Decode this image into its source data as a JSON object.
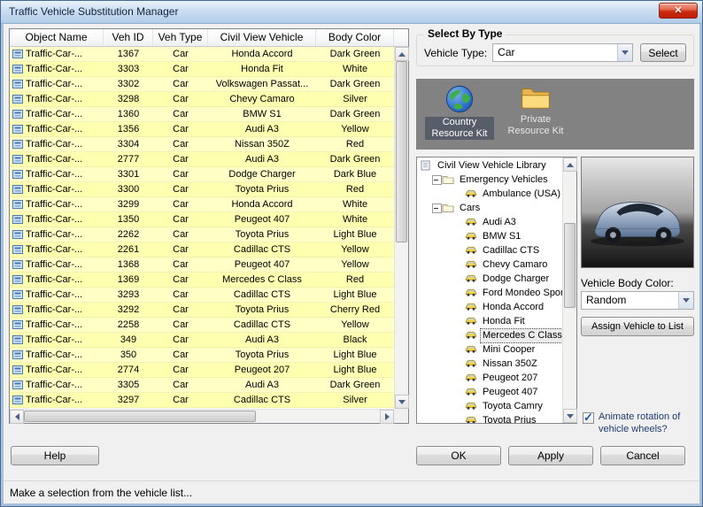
{
  "window": {
    "title": "Traffic Vehicle Substitution Manager"
  },
  "icons": {
    "close": "✕",
    "check": "✓"
  },
  "table": {
    "columns": [
      "Object Name",
      "Veh ID",
      "Veh Type",
      "Civil View Vehicle",
      "Body Color"
    ],
    "rows": [
      {
        "name": "Traffic-Car-...",
        "id": "1367",
        "type": "Car",
        "vehicle": "Honda Accord",
        "color": "Dark Green"
      },
      {
        "name": "Traffic-Car-...",
        "id": "3303",
        "type": "Car",
        "vehicle": "Honda Fit",
        "color": "White"
      },
      {
        "name": "Traffic-Car-...",
        "id": "3302",
        "type": "Car",
        "vehicle": "Volkswagen Passat...",
        "color": "Dark Green"
      },
      {
        "name": "Traffic-Car-...",
        "id": "3298",
        "type": "Car",
        "vehicle": "Chevy Camaro",
        "color": "Silver"
      },
      {
        "name": "Traffic-Car-...",
        "id": "1360",
        "type": "Car",
        "vehicle": "BMW S1",
        "color": "Dark Green"
      },
      {
        "name": "Traffic-Car-...",
        "id": "1356",
        "type": "Car",
        "vehicle": "Audi A3",
        "color": "Yellow"
      },
      {
        "name": "Traffic-Car-...",
        "id": "3304",
        "type": "Car",
        "vehicle": "Nissan 350Z",
        "color": "Red"
      },
      {
        "name": "Traffic-Car-...",
        "id": "2777",
        "type": "Car",
        "vehicle": "Audi A3",
        "color": "Dark Green"
      },
      {
        "name": "Traffic-Car-...",
        "id": "3301",
        "type": "Car",
        "vehicle": "Dodge Charger",
        "color": "Dark Blue"
      },
      {
        "name": "Traffic-Car-...",
        "id": "3300",
        "type": "Car",
        "vehicle": "Toyota Prius",
        "color": "Red"
      },
      {
        "name": "Traffic-Car-...",
        "id": "3299",
        "type": "Car",
        "vehicle": "Honda Accord",
        "color": "White"
      },
      {
        "name": "Traffic-Car-...",
        "id": "1350",
        "type": "Car",
        "vehicle": "Peugeot 407",
        "color": "White"
      },
      {
        "name": "Traffic-Car-...",
        "id": "2262",
        "type": "Car",
        "vehicle": "Toyota Prius",
        "color": "Light Blue"
      },
      {
        "name": "Traffic-Car-...",
        "id": "2261",
        "type": "Car",
        "vehicle": "Cadillac CTS",
        "color": "Yellow"
      },
      {
        "name": "Traffic-Car-...",
        "id": "1368",
        "type": "Car",
        "vehicle": "Peugeot 407",
        "color": "Yellow"
      },
      {
        "name": "Traffic-Car-...",
        "id": "1369",
        "type": "Car",
        "vehicle": "Mercedes C Class",
        "color": "Red"
      },
      {
        "name": "Traffic-Car-...",
        "id": "3293",
        "type": "Car",
        "vehicle": "Cadillac CTS",
        "color": "Light Blue"
      },
      {
        "name": "Traffic-Car-...",
        "id": "3292",
        "type": "Car",
        "vehicle": "Toyota Prius",
        "color": "Cherry Red"
      },
      {
        "name": "Traffic-Car-...",
        "id": "2258",
        "type": "Car",
        "vehicle": "Cadillac CTS",
        "color": "Yellow"
      },
      {
        "name": "Traffic-Car-...",
        "id": "349",
        "type": "Car",
        "vehicle": "Audi A3",
        "color": "Black"
      },
      {
        "name": "Traffic-Car-...",
        "id": "350",
        "type": "Car",
        "vehicle": "Toyota Prius",
        "color": "Light Blue"
      },
      {
        "name": "Traffic-Car-...",
        "id": "2774",
        "type": "Car",
        "vehicle": "Peugeot 207",
        "color": "Light Blue"
      },
      {
        "name": "Traffic-Car-...",
        "id": "3305",
        "type": "Car",
        "vehicle": "Audi A3",
        "color": "Dark Green"
      },
      {
        "name": "Traffic-Car-...",
        "id": "3297",
        "type": "Car",
        "vehicle": "Cadillac CTS",
        "color": "Silver"
      }
    ]
  },
  "select_by_type": {
    "group_label": "Select By Type",
    "field_label": "Vehicle Type:",
    "value": "Car",
    "select_button": "Select"
  },
  "resource_kits": {
    "items": [
      {
        "label": "Country Resource Kit",
        "icon": "globe-icon",
        "selected": true
      },
      {
        "label": "Private Resource Kit",
        "icon": "folder-icon",
        "selected": false
      }
    ]
  },
  "tree": {
    "items": [
      {
        "label": "Civil View Vehicle Library",
        "depth": 0,
        "icon": "library"
      },
      {
        "label": "Emergency Vehicles",
        "depth": 1,
        "icon": "folder",
        "expanded": true
      },
      {
        "label": "Ambulance (USA)",
        "depth": 2,
        "icon": "vehicle"
      },
      {
        "label": "Cars",
        "depth": 1,
        "icon": "folder",
        "expanded": true
      },
      {
        "label": "Audi A3",
        "depth": 2,
        "icon": "vehicle"
      },
      {
        "label": "BMW S1",
        "depth": 2,
        "icon": "vehicle"
      },
      {
        "label": "Cadillac CTS",
        "depth": 2,
        "icon": "vehicle"
      },
      {
        "label": "Chevy Camaro",
        "depth": 2,
        "icon": "vehicle"
      },
      {
        "label": "Dodge Charger",
        "depth": 2,
        "icon": "vehicle"
      },
      {
        "label": "Ford Mondeo Sportb",
        "depth": 2,
        "icon": "vehicle"
      },
      {
        "label": "Honda Accord",
        "depth": 2,
        "icon": "vehicle"
      },
      {
        "label": "Honda Fit",
        "depth": 2,
        "icon": "vehicle"
      },
      {
        "label": "Mercedes C Class",
        "depth": 2,
        "icon": "vehicle",
        "selected": true
      },
      {
        "label": "Mini Cooper",
        "depth": 2,
        "icon": "vehicle"
      },
      {
        "label": "Nissan 350Z",
        "depth": 2,
        "icon": "vehicle"
      },
      {
        "label": "Peugeot 207",
        "depth": 2,
        "icon": "vehicle"
      },
      {
        "label": "Peugeot 407",
        "depth": 2,
        "icon": "vehicle"
      },
      {
        "label": "Toyota Camry",
        "depth": 2,
        "icon": "vehicle"
      },
      {
        "label": "Toyota Prius",
        "depth": 2,
        "icon": "vehicle"
      }
    ]
  },
  "vehicle_panel": {
    "body_color_label": "Vehicle Body Color:",
    "body_color_value": "Random",
    "assign_button": "Assign Vehicle to List"
  },
  "wheel_checkbox": {
    "label": "Animate rotation of vehicle wheels?",
    "checked": true
  },
  "footer": {
    "help": "Help",
    "ok": "OK",
    "apply": "Apply",
    "cancel": "Cancel"
  },
  "status": "Make a selection from the vehicle list...",
  "colors": {
    "row_yellow": "#FFFFC6",
    "row_yellow_alt": "#FFFFB0",
    "titlebar_blue": "#CBDDF1",
    "close_red": "#CD2B10",
    "kit_panel_gray": "#828282"
  }
}
